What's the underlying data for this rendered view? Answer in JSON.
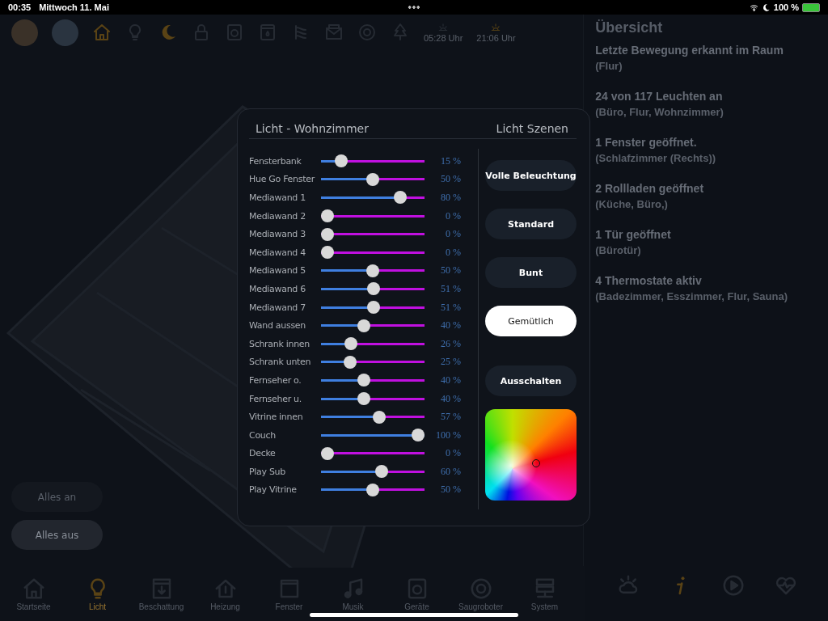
{
  "status_bar": {
    "time": "00:35",
    "date": "Mittwoch 11. Mai",
    "battery": "100 %"
  },
  "top_bar": {
    "icons": [
      {
        "active": true
      },
      {
        "active": false
      },
      {
        "active": true
      },
      {
        "active": false
      },
      {
        "active": false
      },
      {
        "active": false
      },
      {
        "active": false
      },
      {
        "active": false
      },
      {
        "active": false
      },
      {
        "active": false
      }
    ],
    "sun_times": [
      {
        "time": "05:28 Uhr",
        "active": false
      },
      {
        "time": "21:06 Uhr",
        "active": true
      }
    ]
  },
  "quick_buttons": [
    {
      "label": "Alles an",
      "selected": false
    },
    {
      "label": "Alles aus",
      "selected": true
    }
  ],
  "overview": {
    "title": "Übersicht",
    "entries": [
      {
        "headline": "Letzte Bewegung erkannt im Raum",
        "detail": "(Flur)"
      },
      {
        "headline": "24 von 117 Leuchten an",
        "detail": "(Büro, Flur, Wohnzimmer)"
      },
      {
        "headline": "1 Fenster geöffnet.",
        "detail": "(Schlafzimmer (Rechts))"
      },
      {
        "headline": "2 Rollladen geöffnet",
        "detail": "(Küche, Büro,)"
      },
      {
        "headline": "1 Tür geöffnet",
        "detail": "(Bürotür)"
      },
      {
        "headline": "4 Thermostate aktiv",
        "detail": "(Badezimmer, Esszimmer, Flur, Sauna)"
      }
    ]
  },
  "bottom_nav": {
    "items": [
      {
        "label": "Startseite",
        "selected": false
      },
      {
        "label": "Licht",
        "selected": true
      },
      {
        "label": "Beschattung",
        "selected": false
      },
      {
        "label": "Heizung",
        "selected": false
      },
      {
        "label": "Fenster",
        "selected": false
      },
      {
        "label": "Musik",
        "selected": false
      },
      {
        "label": "Geräte",
        "selected": false
      },
      {
        "label": "Saugroboter",
        "selected": false
      },
      {
        "label": "System",
        "selected": false
      }
    ],
    "side_icons": [
      {
        "active": false
      },
      {
        "active": true
      },
      {
        "active": false
      },
      {
        "active": false
      }
    ]
  },
  "dialog": {
    "title": "Licht - Wohnzimmer",
    "scenes_title": "Licht Szenen",
    "lights": [
      {
        "name": "Fensterbank",
        "level": 0.15,
        "reading": "15 %"
      },
      {
        "name": "Hue Go Fenster",
        "level": 0.5,
        "reading": "50 %"
      },
      {
        "name": "Mediawand 1",
        "level": 0.8,
        "reading": "80 %"
      },
      {
        "name": "Mediawand 2",
        "level": 0,
        "reading": "0 %"
      },
      {
        "name": "Mediawand 3",
        "level": 0,
        "reading": "0 %"
      },
      {
        "name": "Mediawand 4",
        "level": 0,
        "reading": "0 %"
      },
      {
        "name": "Mediawand 5",
        "level": 0.5,
        "reading": "50 %"
      },
      {
        "name": "Mediawand 6",
        "level": 0.51,
        "reading": "51 %"
      },
      {
        "name": "Mediawand 7",
        "level": 0.51,
        "reading": "51 %"
      },
      {
        "name": "Wand aussen",
        "level": 0.4,
        "reading": "40 %"
      },
      {
        "name": "Schrank innen",
        "level": 0.26,
        "reading": "26 %"
      },
      {
        "name": "Schrank unten",
        "level": 0.25,
        "reading": "25 %"
      },
      {
        "name": "Fernseher o.",
        "level": 0.4,
        "reading": "40 %"
      },
      {
        "name": "Fernseher u.",
        "level": 0.4,
        "reading": "40 %"
      },
      {
        "name": "Vitrine innen",
        "level": 0.57,
        "reading": "57 %"
      },
      {
        "name": "Couch",
        "level": 1,
        "reading": "100 %"
      },
      {
        "name": "Decke",
        "level": 0,
        "reading": "0 %"
      },
      {
        "name": "Play Sub",
        "level": 0.6,
        "reading": "60 %"
      },
      {
        "name": "Play Vitrine",
        "level": 0.5,
        "reading": "50 %"
      }
    ],
    "scenes": [
      {
        "label": "Volle Beleuchtung",
        "selected": false
      },
      {
        "label": "Standard",
        "selected": false
      },
      {
        "label": "Bunt",
        "selected": false
      },
      {
        "label": "Gemütlich",
        "selected": true
      },
      {
        "label": "Ausschalten",
        "selected": false
      }
    ]
  }
}
